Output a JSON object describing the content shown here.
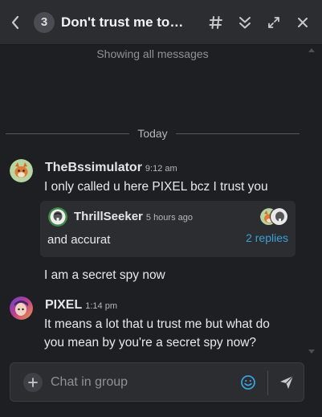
{
  "header": {
    "message_count": "3",
    "title": "Don't trust me too much",
    "icons": [
      "back-arrow-icon",
      "channel-hash-icon",
      "collapse-down-icon",
      "expand-icon",
      "close-icon"
    ]
  },
  "feed": {
    "showing_label": "Showing all messages",
    "divider_label": "Today"
  },
  "messages": [
    {
      "user": "TheBssimulator",
      "time": "9:12 am",
      "text": "I only called u here PIXEL bcz I trust you",
      "thread": {
        "user": "ThrillSeeker",
        "time": "5 hours ago",
        "text": "and accurat",
        "replies": "2 replies"
      },
      "followup": "I am a secret spy now"
    },
    {
      "user": "PIXEL",
      "time": "1:14 pm",
      "text": "It means a lot that u trust me but what do you mean by you're a secret spy now?"
    }
  ],
  "composer": {
    "placeholder": "Chat in group",
    "value": ""
  },
  "colors": {
    "background": "#1e1f22",
    "panel": "#2b2d31",
    "accent_link": "#3aa0d8",
    "text": "#e8e9eb",
    "muted": "#8e9297"
  }
}
